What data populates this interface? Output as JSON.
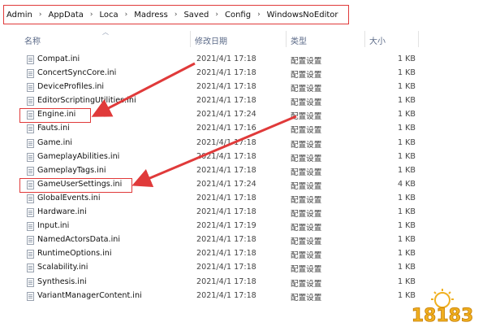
{
  "breadcrumb": [
    "Admin",
    "AppData",
    "Loca",
    "Madress",
    "Saved",
    "Config",
    "WindowsNoEditor"
  ],
  "separator": "›",
  "columns": {
    "name": "名称",
    "date": "修改日期",
    "type": "类型",
    "size": "大小"
  },
  "files": [
    {
      "name": "Compat.ini",
      "date": "2021/4/1 17:18",
      "type": "配置设置",
      "size": "1 KB"
    },
    {
      "name": "ConcertSyncCore.ini",
      "date": "2021/4/1 17:18",
      "type": "配置设置",
      "size": "1 KB"
    },
    {
      "name": "DeviceProfiles.ini",
      "date": "2021/4/1 17:18",
      "type": "配置设置",
      "size": "1 KB"
    },
    {
      "name": "EditorScriptingUtilities.ini",
      "date": "2021/4/1 17:18",
      "type": "配置设置",
      "size": "1 KB"
    },
    {
      "name": "Engine.ini",
      "date": "2021/4/1 17:24",
      "type": "配置设置",
      "size": "1 KB"
    },
    {
      "name": "Fauts.ini",
      "date": "2021/4/1 17:16",
      "type": "配置设置",
      "size": "1 KB"
    },
    {
      "name": "Game.ini",
      "date": "2021/4/1 17:18",
      "type": "配置设置",
      "size": "1 KB"
    },
    {
      "name": "GameplayAbilities.ini",
      "date": "2021/4/1 17:18",
      "type": "配置设置",
      "size": "1 KB"
    },
    {
      "name": "GameplayTags.ini",
      "date": "2021/4/1 17:18",
      "type": "配置设置",
      "size": "1 KB"
    },
    {
      "name": "GameUserSettings.ini",
      "date": "2021/4/1 17:24",
      "type": "配置设置",
      "size": "4 KB"
    },
    {
      "name": "GlobalEvents.ini",
      "date": "2021/4/1 17:18",
      "type": "配置设置",
      "size": "1 KB"
    },
    {
      "name": "Hardware.ini",
      "date": "2021/4/1 17:18",
      "type": "配置设置",
      "size": "1 KB"
    },
    {
      "name": "Input.ini",
      "date": "2021/4/1 17:19",
      "type": "配置设置",
      "size": "1 KB"
    },
    {
      "name": "NamedActorsData.ini",
      "date": "2021/4/1 17:18",
      "type": "配置设置",
      "size": "1 KB"
    },
    {
      "name": "RuntimeOptions.ini",
      "date": "2021/4/1 17:18",
      "type": "配置设置",
      "size": "1 KB"
    },
    {
      "name": "Scalability.ini",
      "date": "2021/4/1 17:18",
      "type": "配置设置",
      "size": "1 KB"
    },
    {
      "name": "Synthesis.ini",
      "date": "2021/4/1 17:18",
      "type": "配置设置",
      "size": "1 KB"
    },
    {
      "name": "VariantManagerContent.ini",
      "date": "2021/4/1 17:18",
      "type": "配置设置",
      "size": "1 KB"
    }
  ],
  "watermark": "18183",
  "colors": {
    "highlight": "#e03a3a",
    "header_text": "#5b6a88",
    "watermark": "#f0b020"
  }
}
